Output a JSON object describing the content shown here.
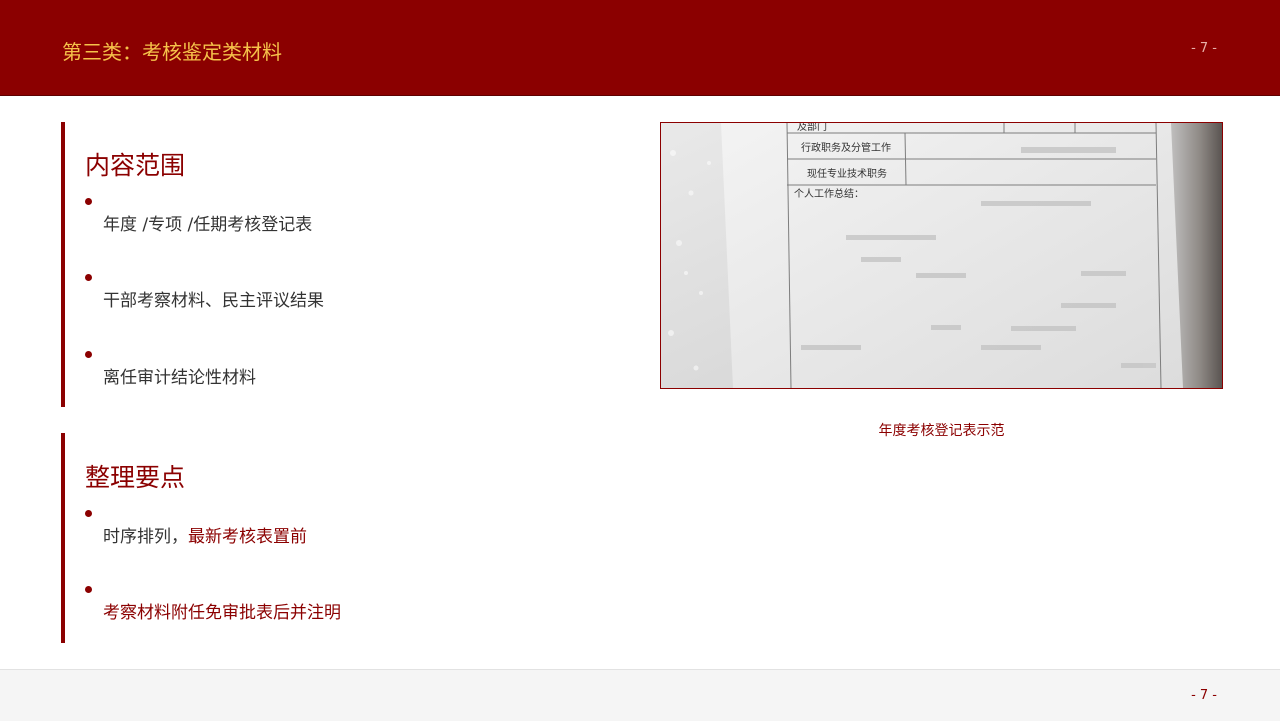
{
  "header": {
    "title": "第三类：考核鉴定类材料",
    "page_number": "- 7 -"
  },
  "section_scope": {
    "title": "内容范围",
    "items": [
      "年度 /专项 /任期考核登记表",
      "干部考察材料、民主评议结果",
      "离任审计结论性材料"
    ]
  },
  "section_tips": {
    "title": "整理要点",
    "item1_prefix": "时序排列，",
    "item1_highlight": "最新考核表置前",
    "item2": "考察材料附任免审批表后并注明"
  },
  "photo": {
    "form_row_top": "及部门",
    "form_row1": "行政职务及分管工作",
    "form_row2": "现任专业技术职务",
    "form_row3": "个人工作总结：",
    "caption": "年度考核登记表示范"
  },
  "footer": {
    "page_number": "- 7 -"
  },
  "colors": {
    "brand_red": "#8b0000",
    "title_gold": "#f5c24a"
  }
}
